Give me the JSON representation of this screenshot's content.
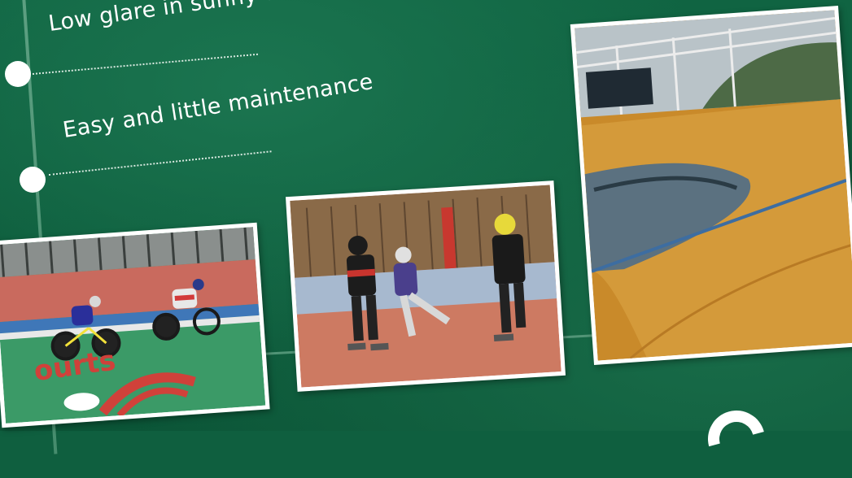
{
  "features": [
    {
      "text": "Low glare in sunny weather con"
    },
    {
      "text": "Easy and little maintenance"
    }
  ],
  "photos": [
    {
      "subject": "track-cycling-photo",
      "court_lettering": "ourts"
    },
    {
      "subject": "inline-skating-photo"
    },
    {
      "subject": "velodrome-photo"
    }
  ],
  "colors": {
    "background": "#0f5f3f",
    "text": "#ffffff",
    "track_orange": "#c98a2a",
    "court_green": "#3b9a67",
    "court_red": "#d0413a"
  }
}
